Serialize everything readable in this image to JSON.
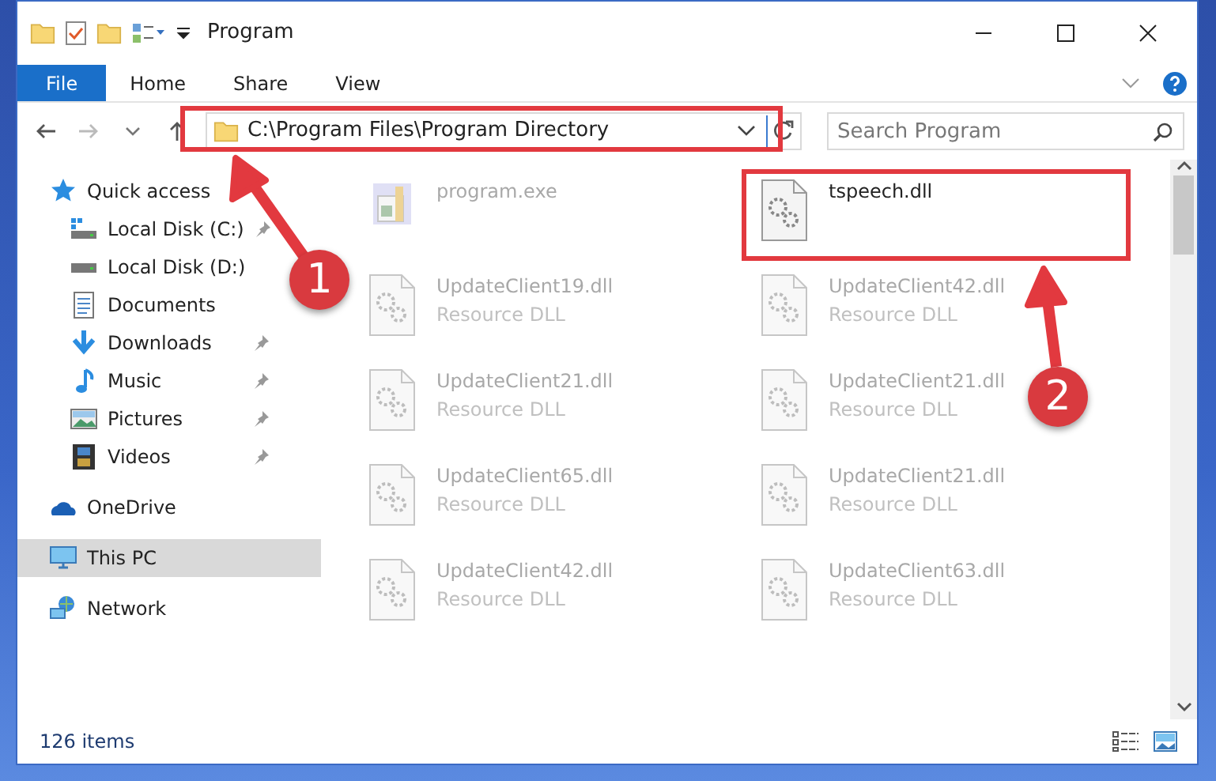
{
  "window": {
    "title": "Program"
  },
  "ribbon_tabs": [
    {
      "label": "File",
      "selected": true
    },
    {
      "label": "Home",
      "selected": false
    },
    {
      "label": "Share",
      "selected": false
    },
    {
      "label": "View",
      "selected": false
    }
  ],
  "address": {
    "path": "C:\\Program Files\\Program Directory"
  },
  "search": {
    "placeholder": "Search Program"
  },
  "sidebar": {
    "items": [
      {
        "label": "Quick access",
        "selected": false,
        "children": [
          {
            "label": "Local Disk (C:)",
            "pinned": true,
            "selected": false
          },
          {
            "label": "Local Disk (D:)",
            "pinned": false,
            "selected": false
          },
          {
            "label": "Documents",
            "pinned": false,
            "selected": false
          },
          {
            "label": "Downloads",
            "pinned": true,
            "selected": false
          },
          {
            "label": "Music",
            "pinned": true,
            "selected": false
          },
          {
            "label": "Pictures",
            "pinned": true,
            "selected": false
          },
          {
            "label": "Videos",
            "pinned": true,
            "selected": false
          }
        ]
      },
      {
        "label": "OneDrive",
        "selected": false
      },
      {
        "label": "This PC",
        "selected": true
      },
      {
        "label": "Network",
        "selected": false
      }
    ]
  },
  "files": [
    {
      "name": "program.exe",
      "kind": "exe",
      "blurred": true,
      "highlighted": false
    },
    {
      "name": "tspeech.dll",
      "kind": "dll",
      "blurred": false,
      "highlighted": true
    },
    {
      "name": "UpdateClient19.dll",
      "type": "Resource DLL",
      "kind": "dll",
      "blurred": true,
      "highlighted": false
    },
    {
      "name": "UpdateClient42.dll",
      "type": "Resource DLL",
      "kind": "dll",
      "blurred": true,
      "highlighted": false
    },
    {
      "name": "UpdateClient21.dll",
      "type": "Resource DLL",
      "kind": "dll",
      "blurred": true,
      "highlighted": false
    },
    {
      "name": "UpdateClient21.dll",
      "type": "Resource DLL",
      "kind": "dll",
      "blurred": true,
      "highlighted": false
    },
    {
      "name": "UpdateClient65.dll",
      "type": "Resource DLL",
      "kind": "dll",
      "blurred": true,
      "highlighted": false
    },
    {
      "name": "UpdateClient21.dll",
      "type": "Resource DLL",
      "kind": "dll",
      "blurred": true,
      "highlighted": false
    },
    {
      "name": "UpdateClient42.dll",
      "type": "Resource DLL",
      "kind": "dll",
      "blurred": true,
      "highlighted": false
    },
    {
      "name": "UpdateClient63.dll",
      "type": "Resource DLL",
      "kind": "dll",
      "blurred": true,
      "highlighted": false
    }
  ],
  "status_bar": {
    "count": "126 items"
  },
  "annotations": [
    {
      "number": "1"
    },
    {
      "number": "2"
    }
  ]
}
